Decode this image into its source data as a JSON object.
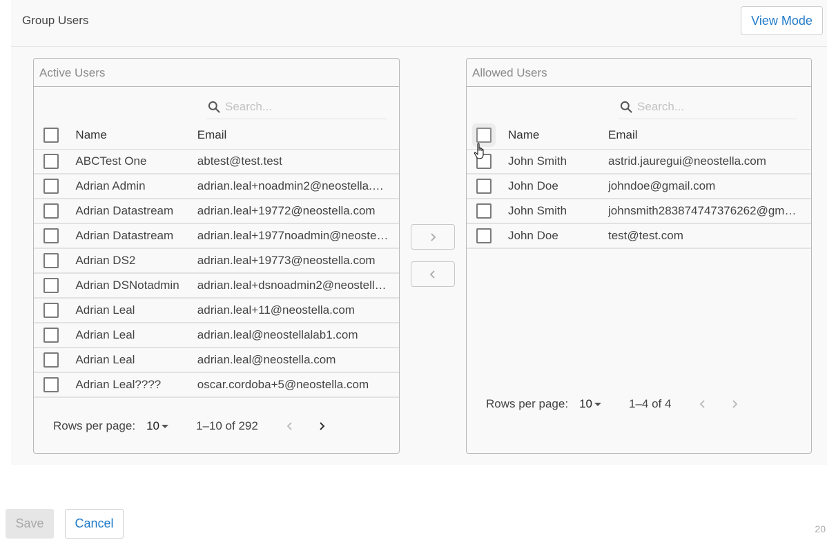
{
  "header": {
    "title": "Group Users",
    "view_mode_label": "View Mode"
  },
  "active_users": {
    "title": "Active Users",
    "search_placeholder": "Search...",
    "columns": {
      "name": "Name",
      "email": "Email"
    },
    "rows": [
      {
        "name": "ABCTest One",
        "email": "abtest@test.test"
      },
      {
        "name": "Adrian Admin",
        "email": "adrian.leal+noadmin2@neostella.…"
      },
      {
        "name": "Adrian Datastream",
        "email": "adrian.leal+19772@neostella.com"
      },
      {
        "name": "Adrian Datastream",
        "email": "adrian.leal+1977noadmin@neoste…"
      },
      {
        "name": "Adrian DS2",
        "email": "adrian.leal+19773@neostella.com"
      },
      {
        "name": "Adrian DSNotadmin",
        "email": "adrian.leal+dsnoadmin2@neostell…"
      },
      {
        "name": "Adrian Leal",
        "email": "adrian.leal+11@neostella.com"
      },
      {
        "name": "Adrian Leal",
        "email": "adrian.leal@neostellalab1.com"
      },
      {
        "name": "Adrian Leal",
        "email": "adrian.leal@neostella.com"
      },
      {
        "name": "Adrian Leal????",
        "email": "oscar.cordoba+5@neostella.com"
      }
    ],
    "pagination": {
      "rows_per_page_label": "Rows per page:",
      "rows_per_page": "10",
      "range": "1–10 of 292"
    }
  },
  "allowed_users": {
    "title": "Allowed Users",
    "search_placeholder": "Search...",
    "columns": {
      "name": "Name",
      "email": "Email"
    },
    "rows": [
      {
        "name": "John Smith",
        "email": "astrid.jauregui@neostella.com"
      },
      {
        "name": "John Doe",
        "email": "johndoe@gmail.com"
      },
      {
        "name": "John Smith",
        "email": "johnsmith283874747376262@gm…"
      },
      {
        "name": "John Doe",
        "email": "test@test.com"
      }
    ],
    "pagination": {
      "rows_per_page_label": "Rows per page:",
      "rows_per_page": "10",
      "range": "1–4 of 4"
    }
  },
  "transfer": {
    "move_right_icon": "chevron-right-icon",
    "move_left_icon": "chevron-left-icon"
  },
  "footer": {
    "save_label": "Save",
    "cancel_label": "Cancel",
    "page_number": "20"
  },
  "colors": {
    "accent": "#1f7ac9",
    "panel_border": "#b8b8b8",
    "background": "#f9f9f9"
  }
}
